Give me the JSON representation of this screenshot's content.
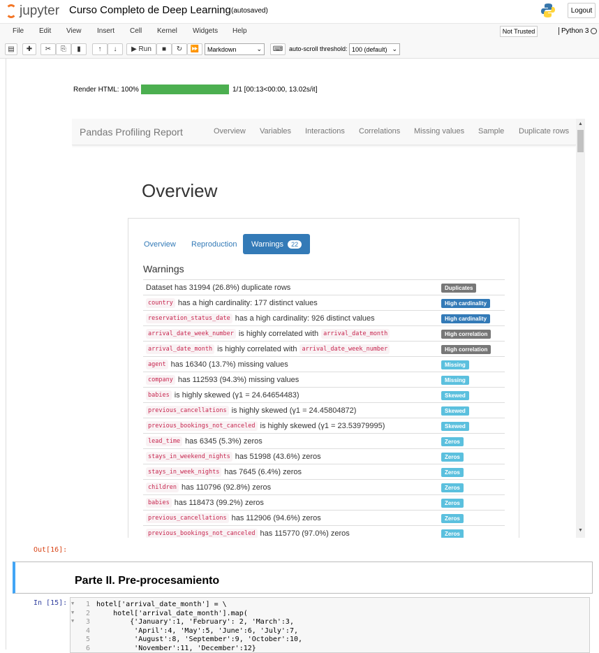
{
  "header": {
    "logo_text": "jupyter",
    "title": "Curso Completo de Deep Learning",
    "autosave": "(autosaved)",
    "logout": "Logout"
  },
  "menu": {
    "items": [
      "File",
      "Edit",
      "View",
      "Insert",
      "Cell",
      "Kernel",
      "Widgets",
      "Help"
    ],
    "trusted": "Not Trusted",
    "kernel": "Python 3"
  },
  "toolbar": {
    "run": "Run",
    "cell_type": "Markdown",
    "autoscroll_label": "auto-scroll threshold:",
    "autoscroll_value": "100 (default)"
  },
  "progress": {
    "label": "Render HTML: 100%",
    "fraction": 1.0,
    "info": "1/1 [00:13<00:00, 13.02s/it]",
    "color": "#4caf50"
  },
  "profile": {
    "brand": "Pandas Profiling Report",
    "nav": [
      "Overview",
      "Variables",
      "Interactions",
      "Correlations",
      "Missing values",
      "Sample",
      "Duplicate rows"
    ],
    "heading": "Overview",
    "tabs": {
      "overview": "Overview",
      "reproduction": "Reproduction",
      "warnings": "Warnings",
      "warnings_count": "22"
    },
    "warnings_heading": "Warnings",
    "warnings": [
      {
        "code": "",
        "text": "Dataset has 31994 (26.8%) duplicate rows",
        "code2": "",
        "badge": "Duplicates",
        "color": "#777777"
      },
      {
        "code": "country",
        "text": "has a high cardinality: 177 distinct values",
        "code2": "",
        "badge": "High cardinality",
        "color": "#337ab7"
      },
      {
        "code": "reservation_status_date",
        "text": "has a high cardinality: 926 distinct values",
        "code2": "",
        "badge": "High cardinality",
        "color": "#337ab7"
      },
      {
        "code": "arrival_date_week_number",
        "text": "is highly correlated with",
        "code2": "arrival_date_month",
        "badge": "High correlation",
        "color": "#777777"
      },
      {
        "code": "arrival_date_month",
        "text": "is highly correlated with",
        "code2": "arrival_date_week_number",
        "badge": "High correlation",
        "color": "#777777"
      },
      {
        "code": "agent",
        "text": "has 16340 (13.7%) missing values",
        "code2": "",
        "badge": "Missing",
        "color": "#5bc0de"
      },
      {
        "code": "company",
        "text": "has 112593 (94.3%) missing values",
        "code2": "",
        "badge": "Missing",
        "color": "#5bc0de"
      },
      {
        "code": "babies",
        "text": "is highly skewed (γ1 = 24.64654483)",
        "code2": "",
        "badge": "Skewed",
        "color": "#5bc0de"
      },
      {
        "code": "previous_cancellations",
        "text": "is highly skewed (γ1 = 24.45804872)",
        "code2": "",
        "badge": "Skewed",
        "color": "#5bc0de"
      },
      {
        "code": "previous_bookings_not_canceled",
        "text": "is highly skewed (γ1 = 23.53979995)",
        "code2": "",
        "badge": "Skewed",
        "color": "#5bc0de"
      },
      {
        "code": "lead_time",
        "text": "has 6345 (5.3%) zeros",
        "code2": "",
        "badge": "Zeros",
        "color": "#5bc0de"
      },
      {
        "code": "stays_in_weekend_nights",
        "text": "has 51998 (43.6%) zeros",
        "code2": "",
        "badge": "Zeros",
        "color": "#5bc0de"
      },
      {
        "code": "stays_in_week_nights",
        "text": "has 7645 (6.4%) zeros",
        "code2": "",
        "badge": "Zeros",
        "color": "#5bc0de"
      },
      {
        "code": "children",
        "text": "has 110796 (92.8%) zeros",
        "code2": "",
        "badge": "Zeros",
        "color": "#5bc0de"
      },
      {
        "code": "babies",
        "text": "has 118473 (99.2%) zeros",
        "code2": "",
        "badge": "Zeros",
        "color": "#5bc0de"
      },
      {
        "code": "previous_cancellations",
        "text": "has 112906 (94.6%) zeros",
        "code2": "",
        "badge": "Zeros",
        "color": "#5bc0de"
      },
      {
        "code": "previous_bookings_not_canceled",
        "text": "has 115770 (97.0%) zeros",
        "code2": "",
        "badge": "Zeros",
        "color": "#5bc0de"
      }
    ]
  },
  "out_prompt": "Out[16]:",
  "markdown_heading": "Parte II. Pre-procesamiento",
  "code_cell": {
    "prompt": "In [15]:",
    "lines": [
      {
        "n": "1",
        "src": "hotel['arrival_date_month'] = \\"
      },
      {
        "n": "2",
        "src": "    hotel['arrival_date_month'].map("
      },
      {
        "n": "3",
        "src": "        {'January':1, 'February': 2, 'March':3,"
      },
      {
        "n": "4",
        "src": "         'April':4, 'May':5, 'June':6, 'July':7,"
      },
      {
        "n": "5",
        "src": "         'August':8, 'September':9, 'October':10,"
      },
      {
        "n": "6",
        "src": "         'November':11, 'December':12}"
      }
    ]
  }
}
